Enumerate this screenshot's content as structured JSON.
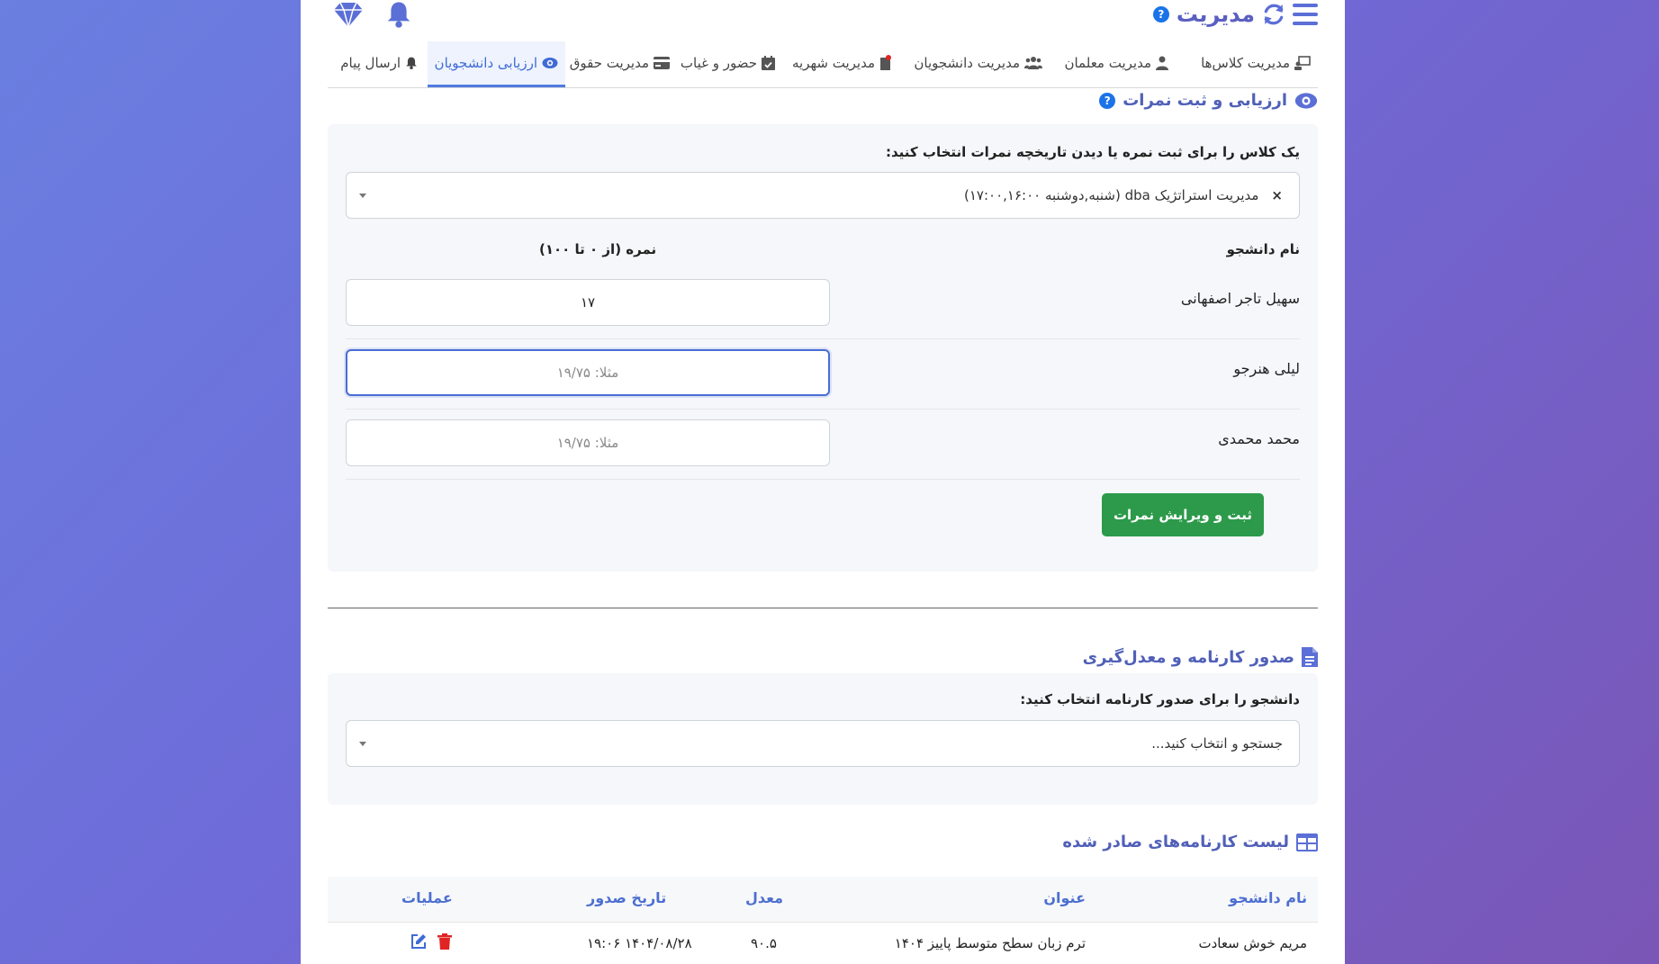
{
  "header": {
    "title": "مدیریت",
    "help_label": "?"
  },
  "tabs": [
    {
      "label": "مدیریت کلاس‌ها",
      "icon": "teacher-board-icon"
    },
    {
      "label": "مدیریت معلمان",
      "icon": "user-icon"
    },
    {
      "label": "مدیریت دانشجویان",
      "icon": "users-icon"
    },
    {
      "label": "مدیریت شهریه",
      "icon": "receipt-icon"
    },
    {
      "label": "حضور و غیاب",
      "icon": "calendar-check-icon"
    },
    {
      "label": "مدیریت حقوق",
      "icon": "credit-card-icon"
    },
    {
      "label": "ارزیابی دانشجویان",
      "icon": "eye-icon",
      "active": true
    },
    {
      "label": "ارسال پیام",
      "icon": "bell-icon"
    }
  ],
  "grading": {
    "title": "ارزیابی و ثبت نمرات",
    "help_label": "?",
    "class_select_label": "یک کلاس را برای ثبت نمره یا دیدن تاریخچه نمرات انتخاب کنید:",
    "selected_class": "مدیریت استراتژیک dba (شنبه,دوشنبه ۱۷:۰۰,۱۶:۰۰)",
    "clear_label": "×",
    "col_student": "نام دانشجو",
    "col_grade": "نمره (از ۰ تا ۱۰۰)",
    "grade_placeholder": "مثلا: ۱۹/۷۵",
    "students": [
      {
        "name": "سهیل تاجر اصفهانی",
        "grade": "۱۷"
      },
      {
        "name": "لیلی هنرجو",
        "grade": ""
      },
      {
        "name": "محمد محمدی",
        "grade": ""
      }
    ],
    "save_button": "ثبت و ویرایش نمرات"
  },
  "report": {
    "title": "صدور کارنامه و معدل‌گیری",
    "select_label": "دانشجو را برای صدور کارنامه انتخاب کنید:",
    "select_placeholder": "جستجو و انتخاب کنید..."
  },
  "issued": {
    "title": "لیست کارنامه‌های صادر شده",
    "columns": {
      "student": "نام دانشجو",
      "term": "عنوان",
      "average": "معدل",
      "date": "تاریخ صدور",
      "ops": "عملیات"
    },
    "rows": [
      {
        "student": "مریم خوش سعادت",
        "term": "ترم زبان سطح متوسط پاییز ۱۴۰۴",
        "average": "۹۰.۵",
        "date": "۱۴۰۴/۰۸/۲۸ ۱۹:۰۶"
      }
    ]
  },
  "colors": {
    "accent": "#4f7be0",
    "success": "#2c9a4a",
    "danger": "#e02424"
  }
}
